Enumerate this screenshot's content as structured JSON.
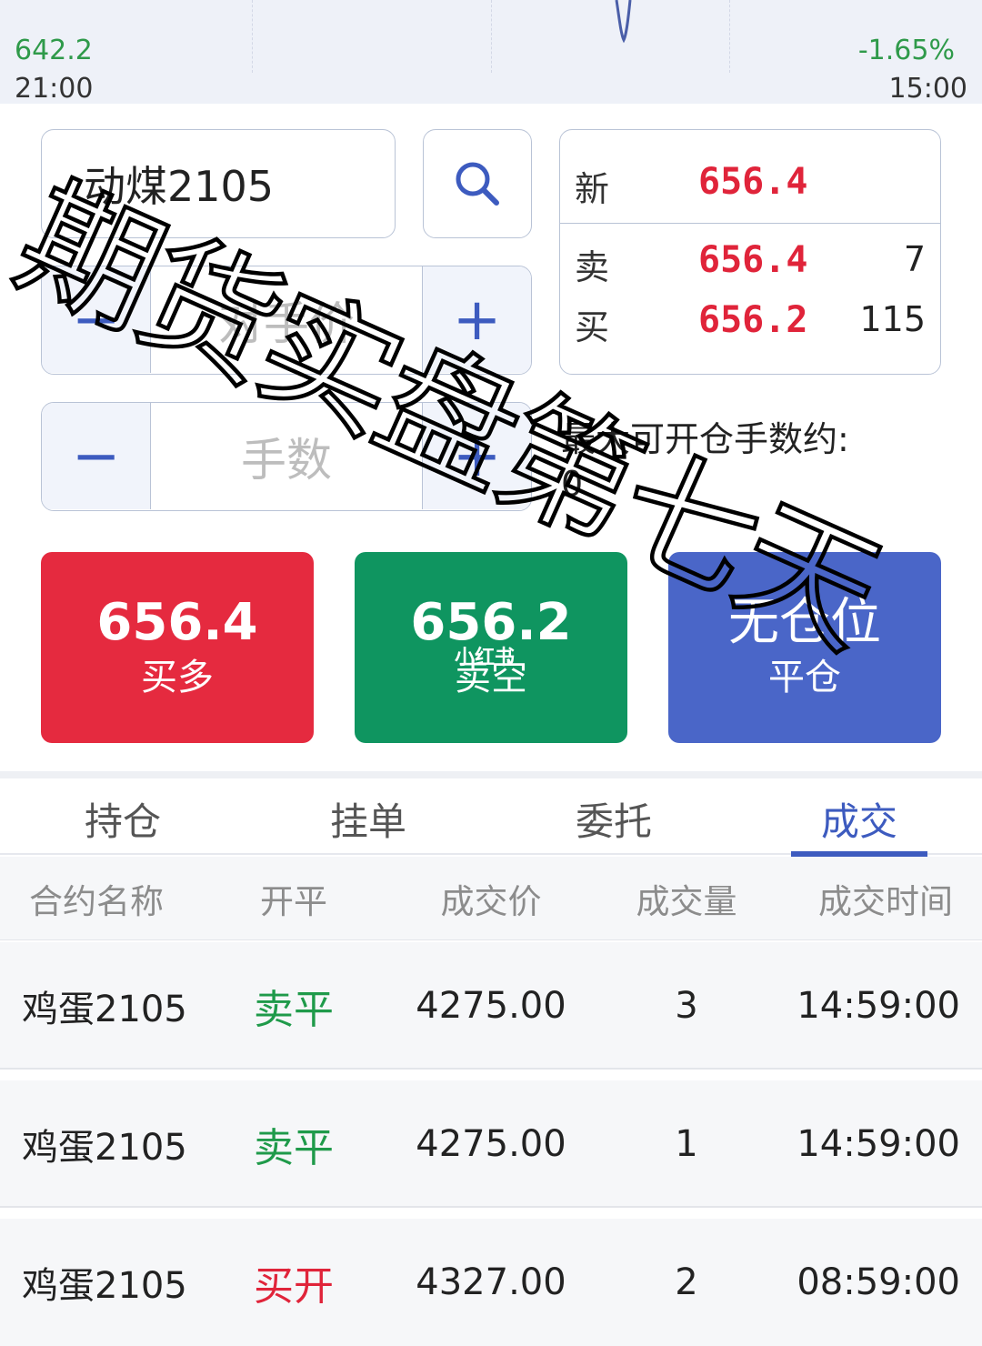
{
  "chart": {
    "left_value": "642.2",
    "right_change": "-1.65%",
    "time_start": "21:00",
    "time_end": "15:00"
  },
  "order": {
    "contract": "动煤2105",
    "price_placeholder": "对手价",
    "qty_placeholder": "手数",
    "plus_symbol": "+",
    "minus_symbol": "−"
  },
  "quote": {
    "last_label": "新",
    "last_price": "656.4",
    "ask_label": "卖",
    "ask_price": "656.4",
    "ask_qty": "7",
    "bid_label": "买",
    "bid_price": "656.2",
    "bid_qty": "115"
  },
  "max_open_label": "最大可开仓手数约:",
  "max_open_value": "0",
  "buttons": {
    "buy_price": "656.4",
    "buy_label": "买多",
    "sell_price": "656.2",
    "sell_label": "卖空",
    "close_status": "无仓位",
    "close_label": "平仓"
  },
  "colors": {
    "buy": "#e52a3f",
    "sell": "#0f9560",
    "close": "#4a66c8",
    "active_tab": "#3d5bbf",
    "sell_close_text": "#1f9a4a",
    "buy_open_text": "#e0243a"
  },
  "tabs": [
    {
      "label": "持仓"
    },
    {
      "label": "挂单"
    },
    {
      "label": "委托"
    },
    {
      "label": "成交"
    }
  ],
  "active_tab_index": 3,
  "table": {
    "headers": [
      "合约名称",
      "开平",
      "成交价",
      "成交量",
      "成交时间"
    ],
    "rows": [
      {
        "name": "鸡蛋2105",
        "action": "卖平",
        "price": "4275.00",
        "qty": "3",
        "time": "14:59:00"
      },
      {
        "name": "鸡蛋2105",
        "action": "卖平",
        "price": "4275.00",
        "qty": "1",
        "time": "14:59:00"
      },
      {
        "name": "鸡蛋2105",
        "action": "买开",
        "price": "4327.00",
        "qty": "2",
        "time": "08:59:00"
      }
    ]
  },
  "watermark": "小红书",
  "overlay_text": "期货实盘第七天"
}
